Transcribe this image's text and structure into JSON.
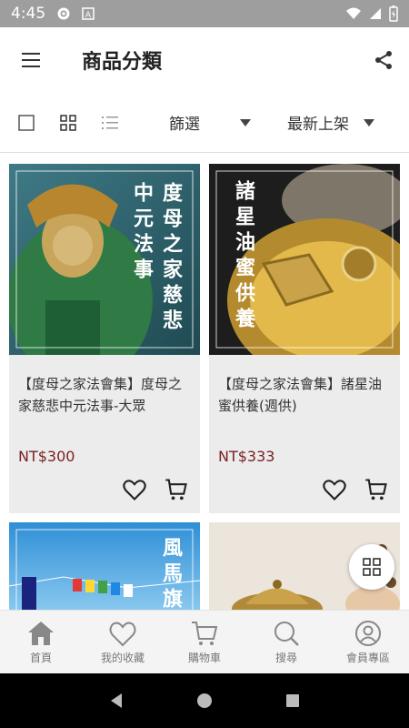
{
  "status": {
    "time": "4:45"
  },
  "header": {
    "title": "商品分類"
  },
  "filters": {
    "filter_label": "篩選",
    "sort_label": "最新上架"
  },
  "products": [
    {
      "name": "【度母之家法會集】度母之家慈悲中元法事-大眾",
      "price": "NT$300",
      "image_title": "度母之家慈悲中元法事"
    },
    {
      "name": "【度母之家法會集】諸星油蜜供養(週供)",
      "price": "NT$333",
      "image_title": "諸星油蜜供養"
    }
  ],
  "partial_products": [
    {
      "image_title": "風馬旗"
    },
    {
      "image_title": ""
    }
  ],
  "bottom_nav": [
    {
      "label": "首頁",
      "icon": "home-icon"
    },
    {
      "label": "我的收藏",
      "icon": "heart-icon"
    },
    {
      "label": "購物車",
      "icon": "cart-icon"
    },
    {
      "label": "搜尋",
      "icon": "search-icon"
    },
    {
      "label": "會員專區",
      "icon": "user-icon"
    }
  ],
  "colors": {
    "price": "#7a1f1f",
    "statusbar": "#9e9e9e",
    "card_bg": "#ececec"
  }
}
